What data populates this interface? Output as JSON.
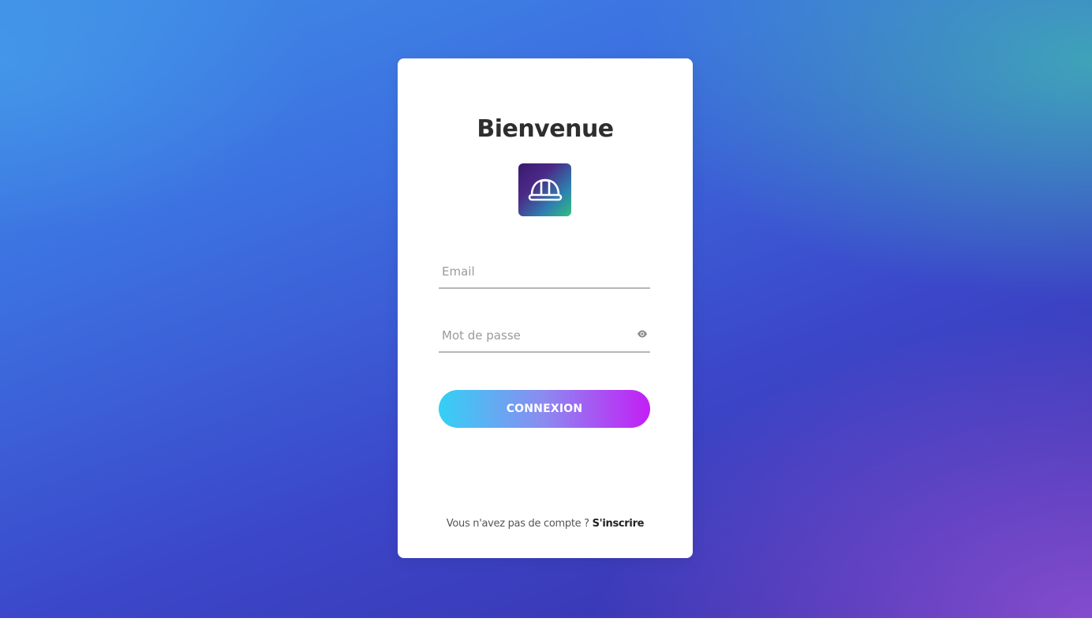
{
  "login": {
    "title": "Bienvenue",
    "logo_icon": "hard-hat-icon",
    "email": {
      "placeholder": "Email",
      "value": ""
    },
    "password": {
      "placeholder": "Mot de passe",
      "value": "",
      "toggle_icon": "eye-icon"
    },
    "submit_label": "CONNEXION",
    "signup_prompt": "Vous n'avez pas de compte ?",
    "signup_link": "S'inscrire"
  },
  "colors": {
    "button_gradient_start": "#34d0f5",
    "button_gradient_end": "#c21ff5",
    "title_color": "#2e2e2e"
  }
}
